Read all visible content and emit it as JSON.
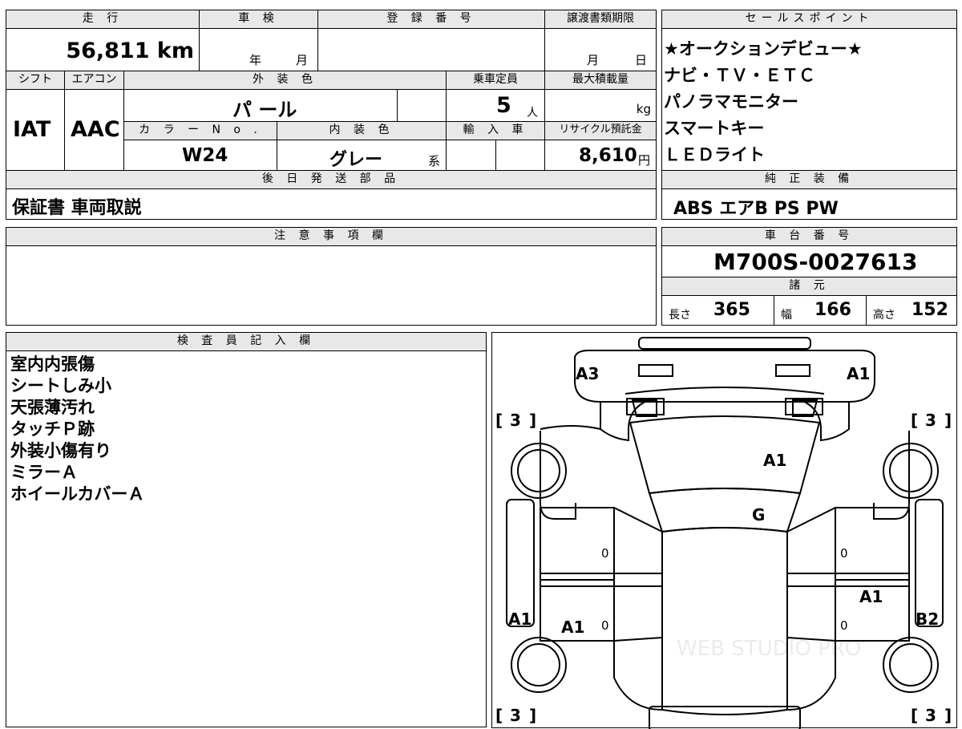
{
  "top": {
    "mileage_label": "走 行",
    "mileage": "56,811 km",
    "inspection_label": "車 検",
    "inspection_year": "年",
    "inspection_month": "月",
    "registration_label": "登 録 番 号",
    "transfer_label": "譲渡書類期限",
    "transfer_month": "月",
    "transfer_day": "日",
    "shift_label": "シフト",
    "shift": "IAT",
    "ac_label": "エアコン",
    "ac": "AAC",
    "exterior_label": "外 装 色",
    "exterior": "パ ール",
    "capacity_label": "乗車定員",
    "capacity": "5",
    "capacity_unit": "人",
    "maxload_label": "最大積載量",
    "maxload_unit": "kg",
    "color_no_label": "カ ラ ー N o .",
    "color_no": "W24",
    "interior_label": "内 装 色",
    "interior": "グレー",
    "interior_suffix": "系",
    "import_label": "輸 入 車",
    "recycle_label": "リサイクル預託金",
    "recycle": "8,610",
    "recycle_unit": "円",
    "later_parts_label": "後 日 発 送 部 品",
    "later_parts": "保証書 車両取説"
  },
  "sales": {
    "label": "セールスポイント",
    "lines": [
      "★オークションデビュー★",
      "ナビ・ＴＶ・ＥＴＣ",
      "パノラマモニター",
      "スマートキー",
      "ＬＥＤライト"
    ]
  },
  "equipment": {
    "label": "純 正 装 備",
    "value": "ABS エアB PS PW"
  },
  "notes": {
    "label": "注 意 事 項 欄",
    "value": ""
  },
  "chassis": {
    "label": "車 台 番 号",
    "value": "M700S-0027613"
  },
  "specs": {
    "label": "諸 元",
    "length_label": "長さ",
    "length": "365",
    "width_label": "幅",
    "width": "166",
    "height_label": "高さ",
    "height": "152"
  },
  "inspector": {
    "label": "検 査 員 記 入 欄",
    "lines": [
      "室内内張傷",
      "シートしみ小",
      "天張薄汚れ",
      "タッチＰ跡",
      "外装小傷有り",
      "ミラーＡ",
      "ホイールカバーＡ"
    ]
  },
  "diagram": {
    "marks": {
      "a3_front_left": "A3",
      "a1_front_right": "A1",
      "hood": "A1",
      "windshield": "G",
      "left_rear_fender": "A1",
      "left_rear_door": "A1",
      "right_rear_door": "A1",
      "right_rear_fender": "B2",
      "door_fl": "0",
      "door_rl": "0",
      "door_fr": "0",
      "door_rr": "0"
    },
    "tread": {
      "fl": "3",
      "fr": "3",
      "rl": "3",
      "rr": "3"
    },
    "watermark": "WEB STUDIO PRO"
  },
  "colors": {
    "header_bg": "#e8e8e8",
    "line": "#000000"
  }
}
